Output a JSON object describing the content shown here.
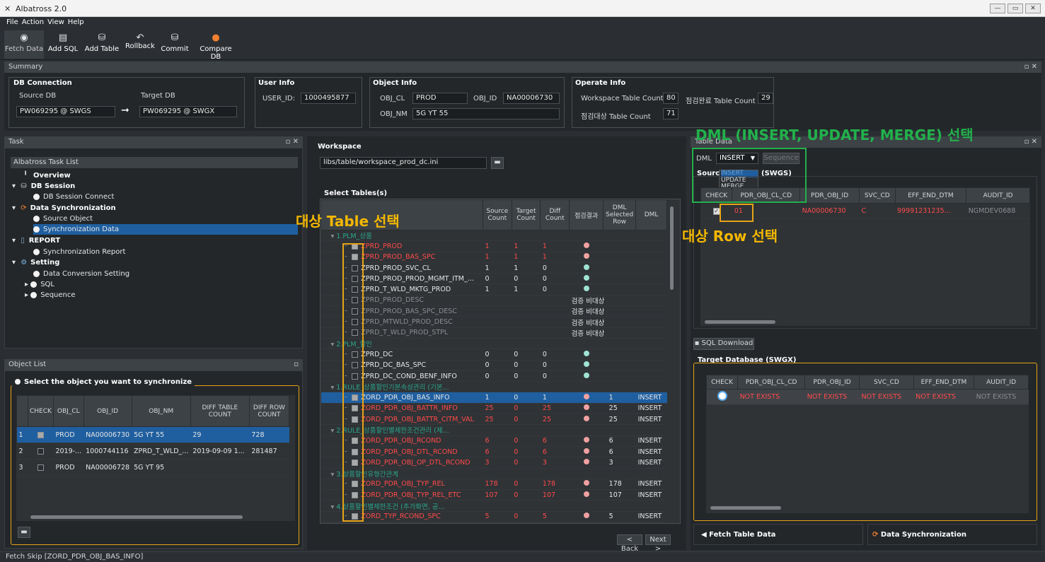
{
  "app": {
    "title": "Albatross 2.0"
  },
  "menu": [
    "File",
    "Action",
    "View",
    "Help"
  ],
  "toolbar": [
    {
      "label": "Fetch Data",
      "icon": "eye-icon"
    },
    {
      "label": "Add SQL",
      "icon": "sql-icon"
    },
    {
      "label": "Add Table",
      "icon": "table-icon"
    },
    {
      "label": "Rollback",
      "icon": "rollback-icon"
    },
    {
      "label": "Commit",
      "icon": "commit-icon"
    },
    {
      "label": "Compare DB",
      "icon": "compare-db-icon"
    }
  ],
  "summary": {
    "title": "Summary",
    "db_connection": "DB Connection",
    "source_db_label": "Source DB",
    "target_db_label": "Target DB",
    "source_db": "PW069295 @ SWGS",
    "target_db": "PW069295 @ SWGX",
    "user_info": "User Info",
    "user_id_label": "USER_ID:",
    "user_id": "1000495877",
    "object_info": "Object Info",
    "obj_cl_label": "OBJ_CL",
    "obj_cl": "PROD",
    "obj_id_label": "OBJ_ID",
    "obj_id": "NA00006730",
    "obj_nm_label": "OBJ_NM",
    "obj_nm": "5G YT 55",
    "operate_info": "Operate Info",
    "ws_count_label": "Workspace Table Count",
    "ws_count": "80",
    "done_count_label": "점검완료 Table Count",
    "done_count": "29",
    "target_count_label": "점검대상 Table Count",
    "target_count": "71"
  },
  "task": {
    "title": "Task",
    "list_title": "Albatross Task List",
    "items": [
      "Overview",
      "DB Session",
      "DB Session Connect",
      "Data Synchronization",
      "Source Object",
      "Synchronization Data",
      "REPORT",
      "Synchronization Report",
      "Setting",
      "Data Conversion Setting",
      "SQL",
      "Sequence"
    ]
  },
  "object_list": {
    "title": "Object List",
    "section": "Select the object you want to synchronize",
    "columns": [
      "CHECK",
      "OBJ_CL",
      "OBJ_ID",
      "OBJ_NM",
      "DIFF TABLE COUNT",
      "DIFF ROW COUNT"
    ],
    "rows": [
      [
        "1",
        "PROD",
        "NA00006730",
        "5G YT 55",
        "29",
        "728"
      ],
      [
        "2",
        "2019-...",
        "1000744116",
        "ZPRD_T_WLD_...",
        "2019-09-09 1...",
        "281487"
      ],
      [
        "3",
        "PROD",
        "NA00006728",
        "5G YT 95",
        "",
        ""
      ]
    ]
  },
  "workspace": {
    "label": "Workspace",
    "path": "libs/table/workspace_prod_dc.ini",
    "select_tables": "Select Tables(s)",
    "columns": [
      "",
      "Source Count",
      "Target Count",
      "Diff Count",
      "점검결과",
      "DML Selected Row",
      "DML"
    ],
    "rows": [
      {
        "name": "1.PLM_상품",
        "kind": "group"
      },
      {
        "name": "ZPRD_PROD",
        "s": "1",
        "t": "1",
        "d": "1",
        "res": "r",
        "kind": "red"
      },
      {
        "name": "ZPRD_PROD_BAS_SPC",
        "s": "1",
        "t": "1",
        "d": "1",
        "res": "r",
        "kind": "red"
      },
      {
        "name": "ZPRD_PROD_SVC_CL",
        "s": "1",
        "t": "1",
        "d": "0",
        "res": "c",
        "kind": "w"
      },
      {
        "name": "ZPRD_PROD_PROD_MGMT_ITM_...",
        "s": "0",
        "t": "0",
        "d": "0",
        "res": "c",
        "kind": "w"
      },
      {
        "name": "ZPRD_T_WLD_MKTG_PROD",
        "s": "1",
        "t": "1",
        "d": "0",
        "res": "c",
        "kind": "w"
      },
      {
        "name": "ZPRD_PROD_DESC",
        "txt": "검증 비대상",
        "kind": "g"
      },
      {
        "name": "ZPRD_PROD_BAS_SPC_DESC",
        "txt": "검증 비대상",
        "kind": "g"
      },
      {
        "name": "ZPRD_MTWLD_PROD_DESC",
        "txt": "검증 비대상",
        "kind": "g"
      },
      {
        "name": "ZPRD_T_WLD_PROD_STPL",
        "txt": "검증 비대상",
        "kind": "g"
      },
      {
        "name": "2.PLM_할인",
        "kind": "group"
      },
      {
        "name": "ZPRD_DC",
        "s": "0",
        "t": "0",
        "d": "0",
        "res": "c",
        "kind": "w"
      },
      {
        "name": "ZPRD_DC_BAS_SPC",
        "s": "0",
        "t": "0",
        "d": "0",
        "res": "c",
        "kind": "w"
      },
      {
        "name": "ZPRD_DC_COND_BENF_INFO",
        "s": "0",
        "t": "0",
        "d": "0",
        "res": "c",
        "kind": "w"
      },
      {
        "name": "1.RULE_상품할인기본속성관리 (기본...",
        "kind": "group"
      },
      {
        "name": "ZORD_PDR_OBJ_BAS_INFO",
        "s": "1",
        "t": "0",
        "d": "1",
        "res": "r",
        "sel": "1",
        "dml": "INSERT",
        "kind": "sel"
      },
      {
        "name": "ZORD_PDR_OBJ_BATTR_INFO",
        "s": "25",
        "t": "0",
        "d": "25",
        "res": "r",
        "sel": "25",
        "dml": "INSERT",
        "kind": "red"
      },
      {
        "name": "ZORD_PDR_OBJ_BATTR_CITM_VAL",
        "s": "25",
        "t": "0",
        "d": "25",
        "res": "r",
        "sel": "25",
        "dml": "INSERT",
        "kind": "red"
      },
      {
        "name": "2.RULE_상품할인별제한조건관리 (제...",
        "kind": "group"
      },
      {
        "name": "ZORD_PDR_OBJ_RCOND",
        "s": "6",
        "t": "0",
        "d": "6",
        "res": "r",
        "sel": "6",
        "dml": "INSERT",
        "kind": "red"
      },
      {
        "name": "ZORD_PDR_OBJ_DTL_RCOND",
        "s": "6",
        "t": "0",
        "d": "6",
        "res": "r",
        "sel": "6",
        "dml": "INSERT",
        "kind": "red"
      },
      {
        "name": "ZORD_PDR_OBJ_OP_DTL_RCOND",
        "s": "3",
        "t": "0",
        "d": "3",
        "res": "r",
        "sel": "3",
        "dml": "INSERT",
        "kind": "red"
      },
      {
        "name": "3.상품할인유형간관계",
        "kind": "group"
      },
      {
        "name": "ZORD_PDR_OBJ_TYP_REL",
        "s": "178",
        "t": "0",
        "d": "178",
        "res": "r",
        "sel": "178",
        "dml": "INSERT",
        "kind": "red"
      },
      {
        "name": "ZORD_PDR_OBJ_TYP_REL_ETC",
        "s": "107",
        "t": "0",
        "d": "107",
        "res": "r",
        "sel": "107",
        "dml": "INSERT",
        "kind": "red"
      },
      {
        "name": "4.상품할인별제한조건 (추가화면, 공...",
        "kind": "group"
      },
      {
        "name": "ZORD_TYP_RCOND_SPC",
        "s": "5",
        "t": "0",
        "d": "5",
        "res": "r",
        "sel": "5",
        "dml": "INSERT",
        "kind": "red"
      }
    ],
    "back": "< Back",
    "next": "Next >"
  },
  "table_data": {
    "title": "Table Data",
    "dml_label": "DML",
    "dml_value": "INSERT",
    "sequence": "Sequence",
    "dml_options": [
      "INSERT",
      "UPDATE",
      "MERGE"
    ],
    "source_label": "Sourc",
    "source_db": "(SWGS)",
    "columns": [
      "CHECK",
      "PDR_OBJ_CL_CD",
      "PDR_OBJ_ID",
      "SVC_CD",
      "EFF_END_DTM",
      "AUDIT_ID"
    ],
    "row": [
      "01",
      "NA00006730",
      "C",
      "99991231235...",
      "NGMDEV0688"
    ],
    "sql_download": "SQL Download",
    "target_title": "Target Database (SWGX)",
    "target_row": [
      "NOT EXISTS",
      "NOT EXISTS",
      "NOT EXISTS",
      "NOT EXISTS",
      "NOT EXISTS"
    ],
    "fetch": "Fetch Table Data",
    "sync": "Data Synchronization"
  },
  "annotations": {
    "dml": "DML (INSERT, UPDATE, MERGE) 선택",
    "table": "대상 Table 선택",
    "row": "대상 Row 선택"
  },
  "status": "Fetch Skip [ZORD_PDR_OBJ_BAS_INFO]",
  "colors": {
    "accent": "#e8a317",
    "annotation": "#22b14c",
    "select": "#1f5fa0",
    "error": "#ff4a4a"
  }
}
